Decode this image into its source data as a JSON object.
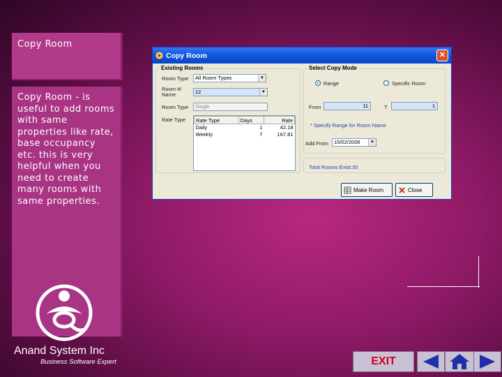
{
  "sidebar": {
    "title": "Copy Room",
    "description": "Copy Room - is useful to add rooms with same properties like rate, base occupancy etc. this is very helpful when you need to create many rooms with same properties."
  },
  "company": {
    "name": "Anand System Inc",
    "tagline": "Business Software Expert"
  },
  "nav": {
    "exit_label": "EXIT",
    "prev_icon": "triangle-left-icon",
    "home_icon": "home-icon",
    "next_icon": "triangle-right-icon"
  },
  "window": {
    "title": "Copy Room",
    "existing_rooms": {
      "label": "Existing Rooms",
      "room_type_label": "Room Type",
      "room_type_value": "All Room Types",
      "room_name_label_1": "Room #/",
      "room_name_label_2": "Name",
      "room_name_value": "12",
      "room_type2_label": "Room Type",
      "room_type2_value": "Single",
      "rate_type_label": "Rate Type",
      "rate_columns": [
        "Rate Type",
        "Days",
        "Rate"
      ],
      "rate_rows": [
        {
          "type": "Daily",
          "days": "1",
          "rate": "42.18"
        },
        {
          "type": "Weekly",
          "days": "7",
          "rate": "167.81"
        }
      ]
    },
    "copy_mode": {
      "label": "Select Copy Mode",
      "range_label": "Range",
      "specific_label": "Specific Room",
      "from_label": "From",
      "from_value": "11",
      "to_label": "T",
      "to_value": "1",
      "specify_link": "* Specify Range for Room Name",
      "add_from_label": "Add From",
      "add_from_value": "15/02/2006",
      "total_rooms": "Total Rooms Exist:35"
    },
    "buttons": {
      "make_room": "Make Room",
      "close": "Close"
    }
  },
  "colors": {
    "sidebar_bg": "#a93484",
    "exit_text": "#d4001c",
    "nav_arrow": "#1f2fa8"
  }
}
